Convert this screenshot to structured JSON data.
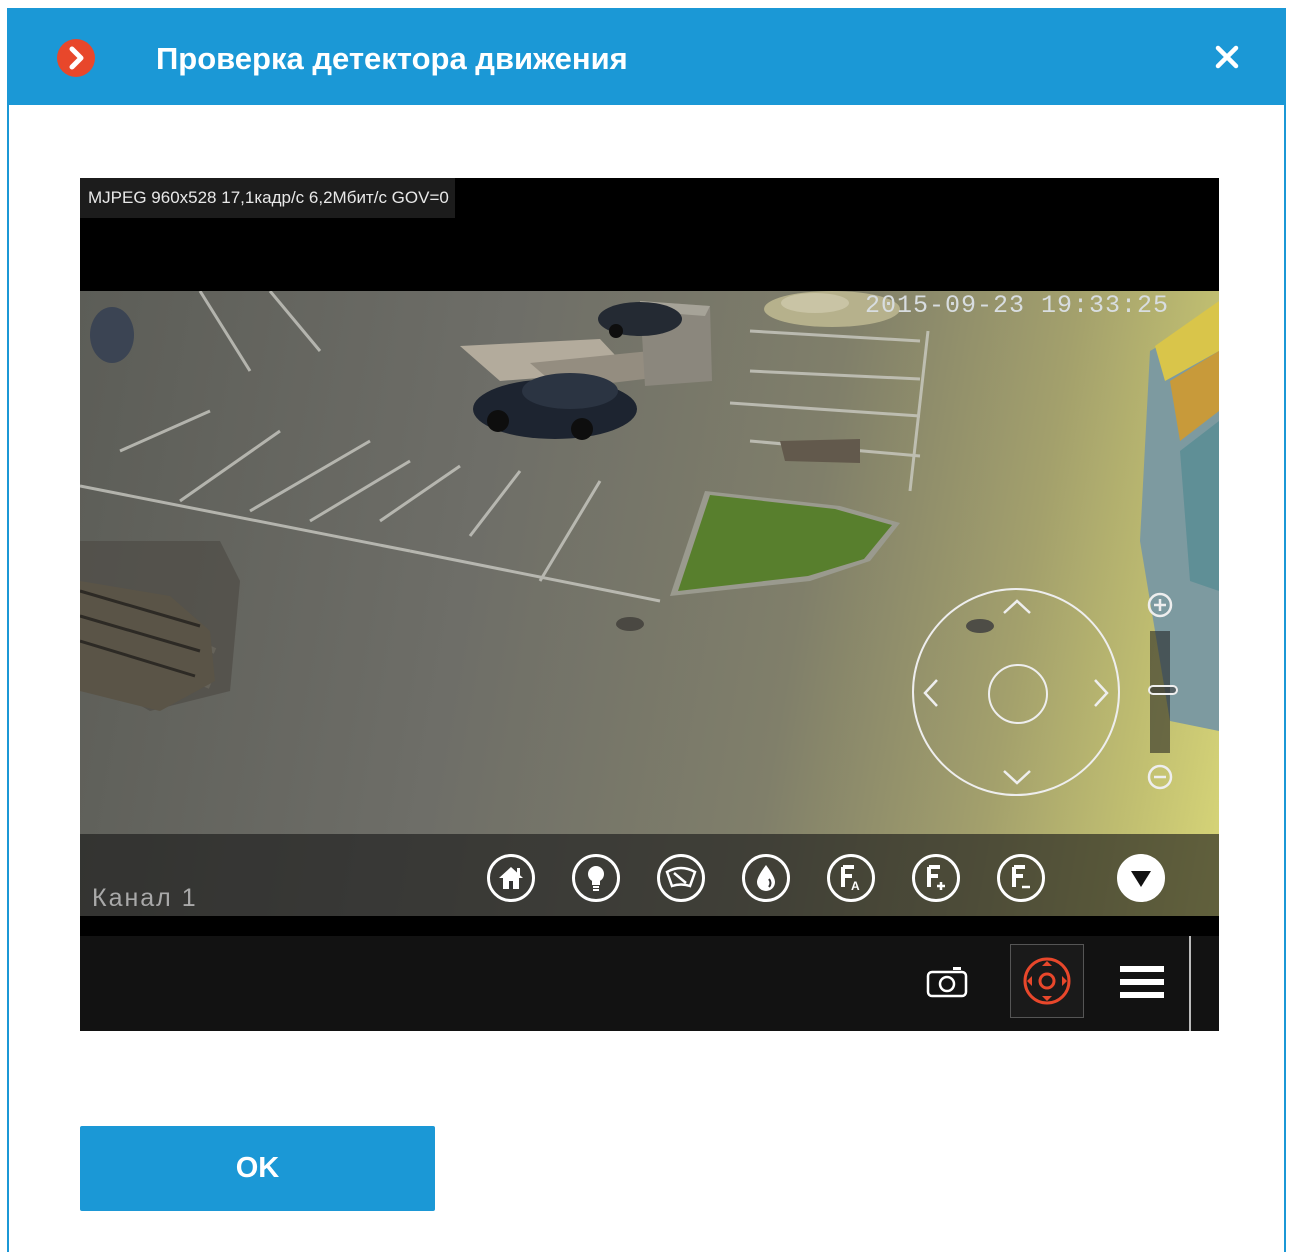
{
  "dialog": {
    "title": "Проверка детектора движения",
    "ok_label": "OK"
  },
  "video": {
    "codec_info": "MJPEG 960x528 17,1кадр/с 6,2Мбит/с GOV=0",
    "timestamp": "2015-09-23 19:33:25",
    "channel_label": "Канал 1"
  },
  "ptz_buttons": [
    "home-icon",
    "light-icon",
    "wiper-icon",
    "washer-icon",
    "focus-auto-icon",
    "focus-plus-icon",
    "focus-minus-icon",
    "collapse-icon"
  ],
  "toolbar_buttons": [
    "snapshot-icon",
    "ptz-control-icon",
    "menu-icon"
  ],
  "colors": {
    "accent": "#1b98d6",
    "app_icon": "#e8472b",
    "ptz_active": "#e8472b"
  }
}
